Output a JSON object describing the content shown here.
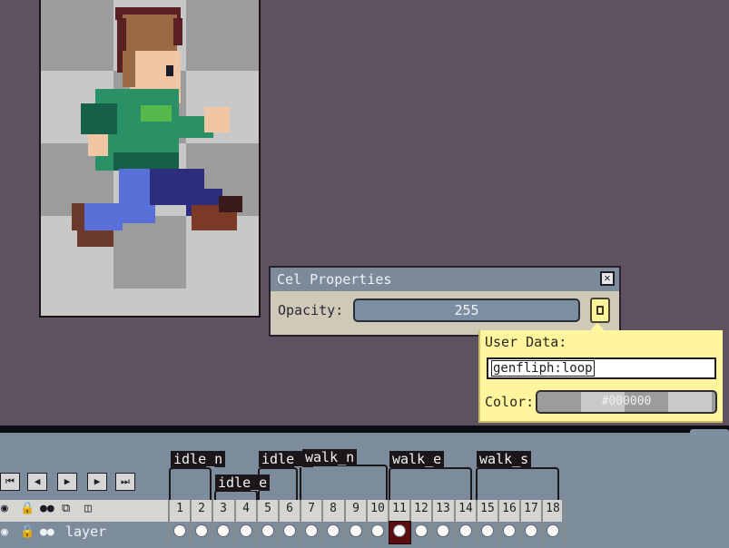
{
  "dialog": {
    "title": "Cel Properties",
    "close_glyph": "✕",
    "opacity_label": "Opacity:",
    "opacity_value": "255",
    "user_data_button_icon": "note-icon"
  },
  "user_data": {
    "label": "User Data:",
    "value": "genfliph:loop",
    "color_label": "Color:",
    "color_value": "#000000"
  },
  "playback": {
    "first_frame": "⏮",
    "prev_frame": "◀",
    "play": "▶",
    "next_frame": "▶",
    "last_frame": "⏭"
  },
  "tags": [
    {
      "label": "idle_n"
    },
    {
      "label": "idle_e"
    },
    {
      "label": "idle_s"
    },
    {
      "label": "walk_n"
    },
    {
      "label": "walk_e"
    },
    {
      "label": "walk_s"
    }
  ],
  "frames": [
    "1",
    "2",
    "3",
    "4",
    "5",
    "6",
    "7",
    "8",
    "9",
    "10",
    "11",
    "12",
    "13",
    "14",
    "15",
    "16",
    "17",
    "18"
  ],
  "active_frame": "11",
  "layer": {
    "name": "layer"
  },
  "colors": {
    "background": "#5e5260",
    "dialog_title": "#7c8a9a",
    "user_data_bg": "#fff59e",
    "timeline_bg": "#7d8c9d",
    "active_cel": "#5a0e10"
  }
}
